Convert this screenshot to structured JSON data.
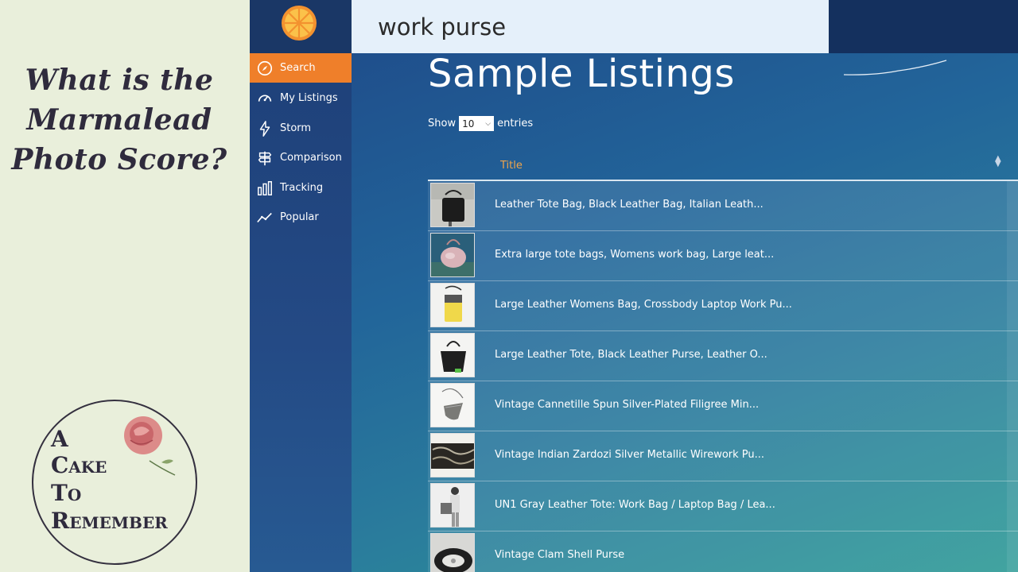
{
  "promo": {
    "title_line1": "What is the",
    "title_line2": "Marmalead",
    "title_line3": "Photo Score?",
    "logo_word1": "A",
    "logo_word2": "Cake",
    "logo_word3": "To",
    "logo_word4": "Remember"
  },
  "app": {
    "search_value": "work purse",
    "nav": [
      {
        "label": "Search",
        "icon": "compass-icon"
      },
      {
        "label": "My Listings",
        "icon": "speedometer-icon"
      },
      {
        "label": "Storm",
        "icon": "lightning-icon"
      },
      {
        "label": "Comparison",
        "icon": "signpost-icon"
      },
      {
        "label": "Tracking",
        "icon": "bar-chart-icon"
      },
      {
        "label": "Popular",
        "icon": "trend-line-icon"
      }
    ],
    "heading": "Sample Listings",
    "show_label": "Show",
    "entries_value": "10",
    "entries_label": "entries",
    "column_title": "Title",
    "listings": [
      "Leather Tote Bag, Black Leather Bag, Italian Leath...",
      "Extra large tote bags, Womens work bag, Large leat...",
      "Large Leather Womens Bag, Crossbody Laptop Work Pu...",
      "Large Leather Tote, Black Leather Purse, Leather O...",
      "Vintage Cannetille Spun Silver-Plated Filigree Min...",
      "Vintage Indian Zardozi Silver Metallic Wirework Pu...",
      "UN1 Gray Leather Tote: Work Bag / Laptop Bag / Lea...",
      "Vintage Clam Shell Purse"
    ]
  },
  "colors": {
    "accent_orange": "#ef7f2a",
    "sidebar_blue": "#1d3f77",
    "header_text_orange": "#f1a54a"
  }
}
